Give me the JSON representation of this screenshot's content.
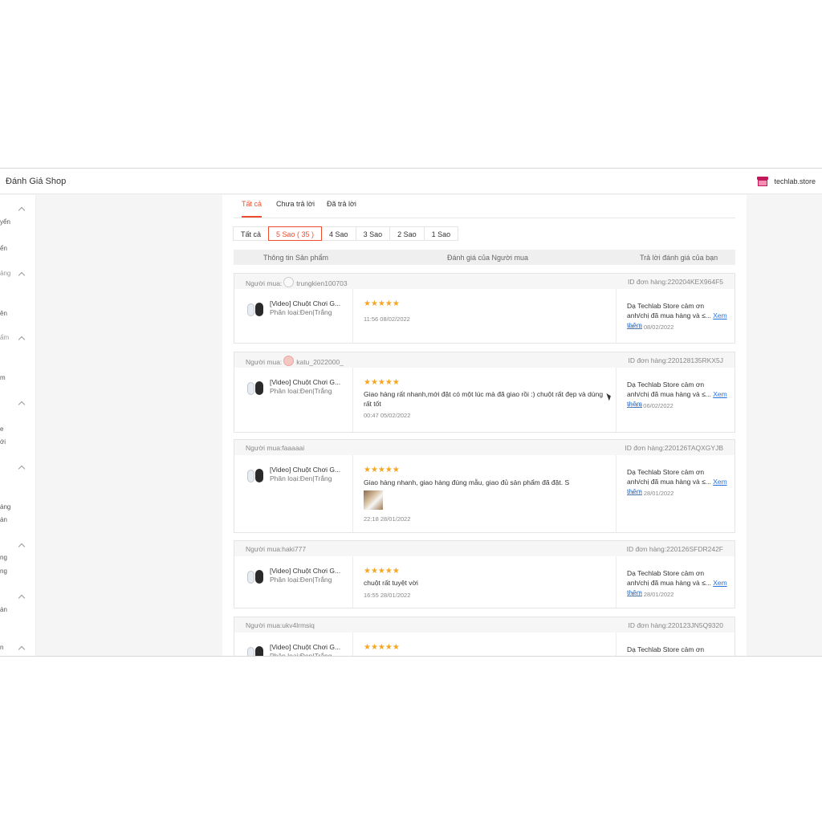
{
  "header": {
    "title": "Đánh Giá Shop",
    "shop_name": "techlab.store"
  },
  "sidebar": {
    "fragments": [
      "yển",
      "ển",
      "ảng",
      "ên",
      "ẩm",
      "m",
      "e",
      "ới",
      "áng",
      "án",
      "ng",
      "ng",
      "án",
      "n"
    ]
  },
  "tabs": [
    "Tất cả",
    "Chưa trả lời",
    "Đã trả lời"
  ],
  "filters": [
    "Tất cả",
    "5 Sao ( 35 )",
    "4 Sao",
    "3 Sao",
    "2 Sao",
    "1 Sao"
  ],
  "table_header": {
    "product": "Thông tin Sản phẩm",
    "review": "Đánh giá của Người mua",
    "reply": "Trả lời đánh giá của bạn"
  },
  "common": {
    "product_name": "[Video] Chuột Chơi G...",
    "product_variant": "Phân loại:Đen|Trắng",
    "reply_text": "Dạ Techlab Store cảm ơn anh/chị đã mua hàng và ≤...",
    "reply_more": "Xem thêm",
    "stars": "★★★★★"
  },
  "reviews": [
    {
      "buyer": "Người mua:",
      "username": "trungkien100703",
      "order_id": "ID đơn hàng:220204KEX964F5",
      "review_text": "",
      "review_time": "11:56 08/02/2022",
      "reply_time": "16:18 08/02/2022"
    },
    {
      "buyer": "Người mua:",
      "username": "katu_2022000_",
      "order_id": "ID đơn hàng:220128135RKX5J",
      "review_text": "Giao hàng rất nhanh,mới đặt có một lúc mà đã giao rồi :) chuột rất đẹp và dùng rất tốt",
      "review_time": "00:47 05/02/2022",
      "reply_time": "11:13 06/02/2022"
    },
    {
      "buyer": "Người mua:faaaaai",
      "username": "",
      "order_id": "ID đơn hàng:220126TAQXGYJB",
      "review_text": "Giao hàng nhanh, giao hàng đúng mẫu, giao đủ sản phẩm đã đặt. S",
      "review_time": "22:18 28/01/2022",
      "reply_time": "23:10 28/01/2022"
    },
    {
      "buyer": "Người mua:haki777",
      "username": "",
      "order_id": "ID đơn hàng:220126SFDR242F",
      "review_text": "chuột rất tuyệt vời",
      "review_time": "16:55 28/01/2022",
      "reply_time": "23:10 28/01/2022"
    },
    {
      "buyer": "Người mua:ukv4lrmsiq",
      "username": "",
      "order_id": "ID đơn hàng:220123JN5Q9320",
      "review_text": "",
      "review_time": "",
      "reply_time": ""
    }
  ],
  "colors": {
    "accent": "#ee4d2d",
    "star": "#f5a623",
    "link": "#2673dd"
  }
}
